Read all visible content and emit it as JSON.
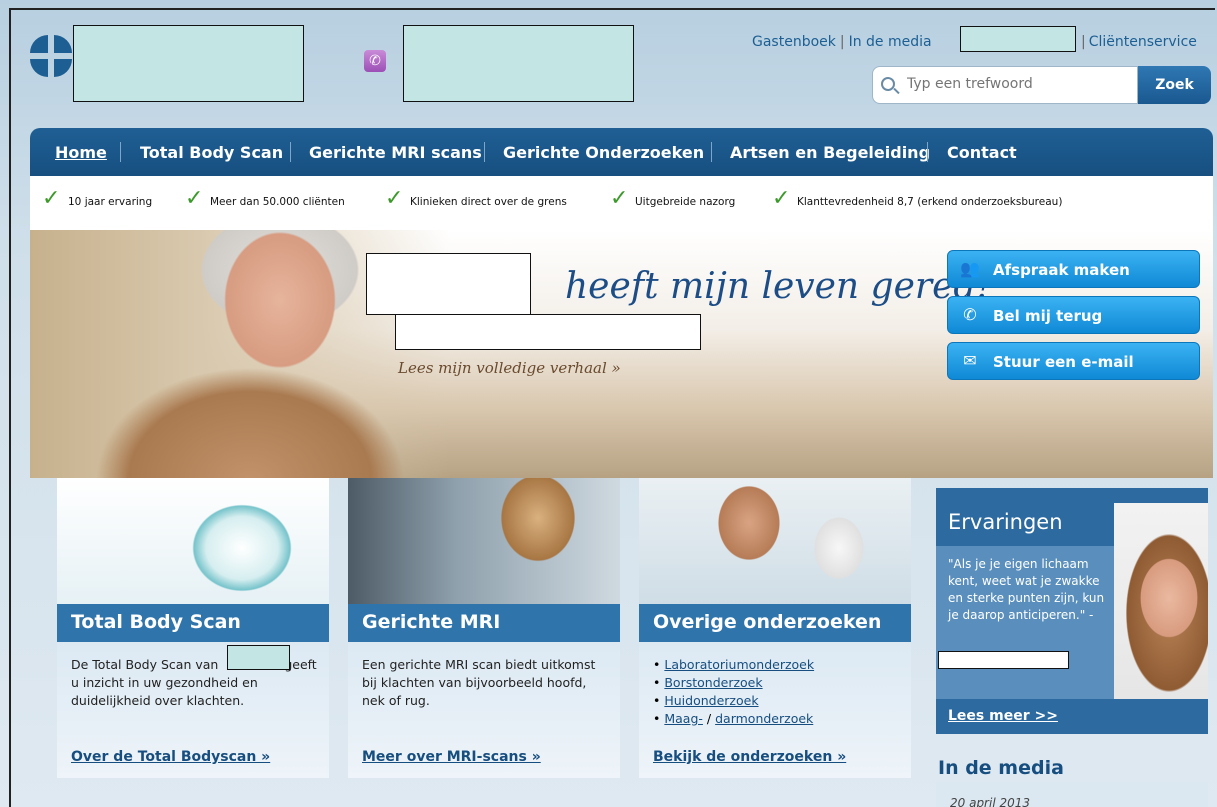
{
  "header": {
    "toplinks": [
      "Gastenboek",
      "In de media",
      "Cliëntenservice"
    ],
    "search_placeholder": "Typ een trefwoord",
    "search_button": "Zoek"
  },
  "nav": [
    "Home",
    "Total Body Scan",
    "Gerichte MRI scans",
    "Gerichte Onderzoeken",
    "Artsen en Begeleiding",
    "Contact"
  ],
  "features": [
    "10 jaar ervaring",
    "Meer dan 50.000 cliënten",
    "Klinieken direct over de grens",
    "Uitgebreide nazorg",
    "Klanttevredenheid 8,7 (erkend onderzoeksbureau)"
  ],
  "hero": {
    "quote": "heeft mijn leven gered!\"",
    "link": "Lees mijn volledige verhaal »",
    "cta": [
      "Afspraak maken",
      "Bel mij terug",
      "Stuur een e-mail"
    ]
  },
  "cards": [
    {
      "title": "Total Body Scan",
      "text_before": "De Total Body Scan van",
      "text_after": "geeft u inzicht in uw gezondheid en duidelijkheid over klachten.",
      "more": "Over de Total Bodyscan »"
    },
    {
      "title": "Gerichte MRI",
      "text": "Een gerichte MRI scan biedt uitkomst bij klachten van bijvoorbeeld hoofd, nek of rug.",
      "more": "Meer over MRI-scans »"
    },
    {
      "title": "Overige onderzoeken",
      "list": [
        "Laboratoriumonderzoek",
        "Borstonderzoek",
        "Huidonderzoek"
      ],
      "last_a": "Maag-",
      "last_sep": "/",
      "last_b": "darmonderzoek",
      "more": "Bekijk de onderzoeken »"
    }
  ],
  "sidebar": {
    "heading": "Ervaringen",
    "quote": "\"Als je je eigen lichaam kent, weet wat je zwakke en sterke punten zijn, kun je daarop anticiperen.\" -",
    "more": "Lees meer >>",
    "media_title": "In de media",
    "media_date": "20 april 2013"
  }
}
